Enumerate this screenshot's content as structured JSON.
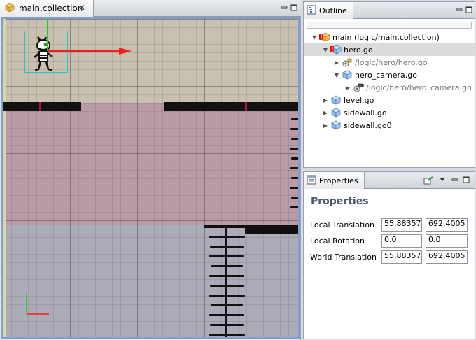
{
  "editor": {
    "tab_label": "main.collection",
    "tab_icon": "collection-icon",
    "close_glyph": "✕"
  },
  "outline": {
    "title": "Outline",
    "items": [
      {
        "label": "main (logic/main.collection)",
        "icon": "collection-warning-icon",
        "expanded": true,
        "selected": false,
        "muted": false
      },
      {
        "label": "hero.go",
        "icon": "gameobject-warning-icon",
        "expanded": true,
        "selected": true,
        "muted": false
      },
      {
        "label": "/logic/hero/hero.go",
        "icon": "component-script-icon",
        "expanded": false,
        "selected": false,
        "muted": true
      },
      {
        "label": "hero_camera.go",
        "icon": "gameobject-icon",
        "expanded": true,
        "selected": false,
        "muted": false
      },
      {
        "label": "/logic/hero/hero_camera.go",
        "icon": "camera-component-icon",
        "expanded": false,
        "selected": false,
        "muted": true
      },
      {
        "label": "level.go",
        "icon": "gameobject-icon",
        "expanded": false,
        "selected": false,
        "muted": false
      },
      {
        "label": "sidewall.go",
        "icon": "gameobject-icon",
        "expanded": false,
        "selected": false,
        "muted": false
      },
      {
        "label": "sidewall.go0",
        "icon": "gameobject-icon",
        "expanded": false,
        "selected": false,
        "muted": false
      }
    ]
  },
  "properties": {
    "title": "Properties",
    "heading": "Properties",
    "rows": [
      {
        "label": "Local Translation",
        "x": "55.88357",
        "y": "692.4005"
      },
      {
        "label": "Local Rotation",
        "x": "0.0",
        "y": "0.0"
      },
      {
        "label": "World Translation",
        "x": "55.88357",
        "y": "692.4005"
      }
    ]
  },
  "colors": {
    "selection_row": "#dcdcdc",
    "viewport_border": "#7f9fd1",
    "axis_x": "#ff1a1a",
    "axis_y": "#22cc22",
    "selection_box": "#29c4c4",
    "heading": "#4a5a72"
  }
}
